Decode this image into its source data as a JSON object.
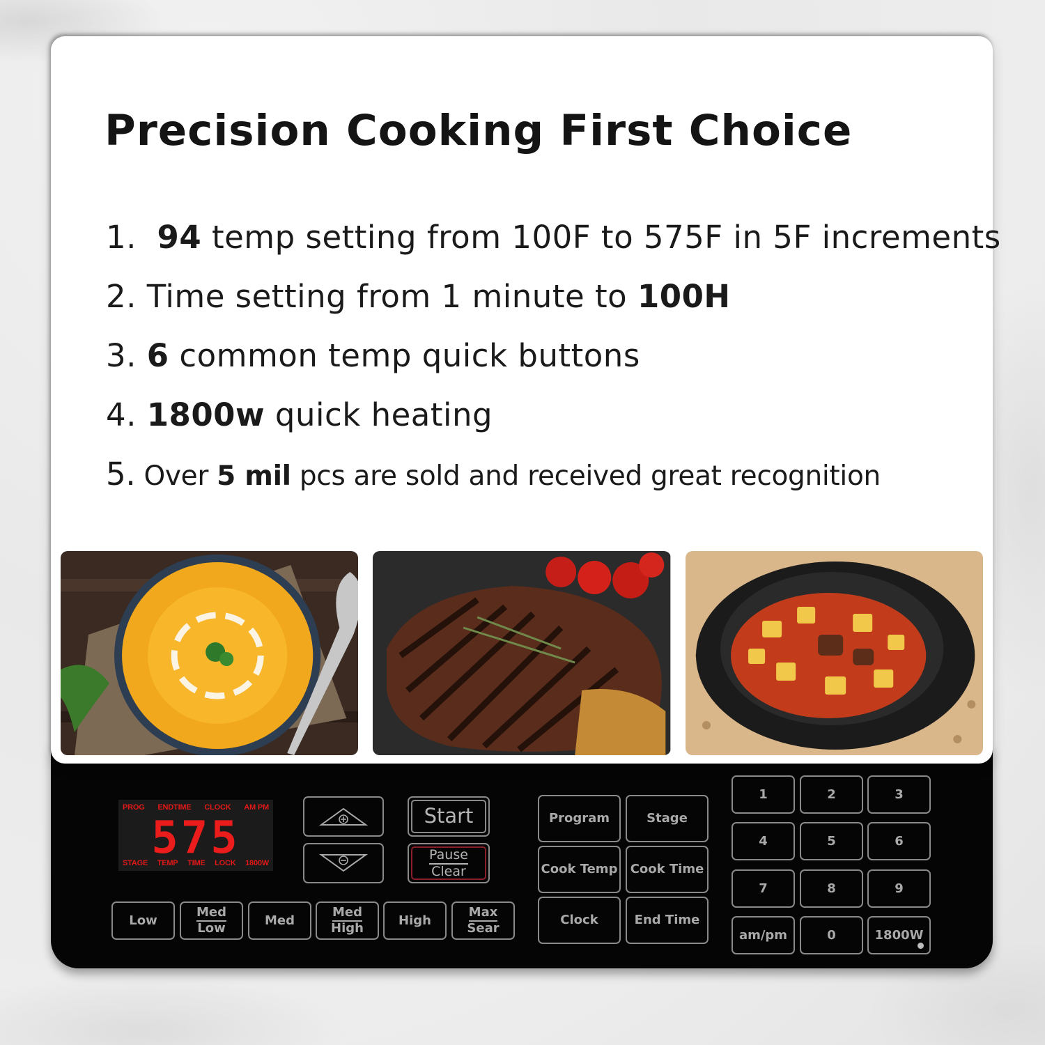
{
  "title": "Precision Cooking First Choice",
  "features": [
    {
      "num": "1.",
      "bold": "94",
      "text": " temp  setting from 100F to 575F in 5F increments",
      "bold_position": "start"
    },
    {
      "num": "2.",
      "pre": "Time setting from 1 minute to ",
      "bold": "100H",
      "bold_position": "end"
    },
    {
      "num": "3.",
      "bold": "6",
      "text": " common temp quick buttons",
      "bold_position": "start"
    },
    {
      "num": "4.",
      "bold": "1800w",
      "text": " quick heating",
      "bold_position": "start"
    },
    {
      "num": "5.",
      "pre": "Over ",
      "bold": "5 mil",
      "text": " pcs are sold and received great recognition",
      "bold_position": "middle"
    }
  ],
  "photos": [
    {
      "name": "pumpkin-soup",
      "alt": "Bowl of pumpkin soup with cream swirl and parsley"
    },
    {
      "name": "grilled-steak",
      "alt": "Grilled steak with rosemary and tomatoes"
    },
    {
      "name": "beef-stew",
      "alt": "Clay pot of beef and potato stew"
    }
  ],
  "display": {
    "top_indicators": [
      "PROG",
      "ENDTIME",
      "CLOCK",
      "AM PM"
    ],
    "value": "575",
    "bottom_indicators": [
      "STAGE",
      "TEMP",
      "TIME",
      "LOCK",
      "1800W"
    ],
    "color": "#e01818"
  },
  "controls": {
    "increase_icon": "plus-triangle-up",
    "decrease_icon": "minus-triangle-down",
    "start": "Start",
    "pause": "Pause",
    "clear": "Clear"
  },
  "presets": [
    {
      "top": "Low"
    },
    {
      "top": "Med",
      "bottom": "Low"
    },
    {
      "top": "Med"
    },
    {
      "top": "Med",
      "bottom": "High"
    },
    {
      "top": "High"
    },
    {
      "top": "Max",
      "bottom": "Sear"
    }
  ],
  "functions": [
    "Program",
    "Stage",
    "Cook Temp",
    "Cook Time",
    "Clock",
    "End Time"
  ],
  "keypad": [
    "1",
    "2",
    "3",
    "4",
    "5",
    "6",
    "7",
    "8",
    "9",
    "am/pm",
    "0",
    "1800W"
  ]
}
